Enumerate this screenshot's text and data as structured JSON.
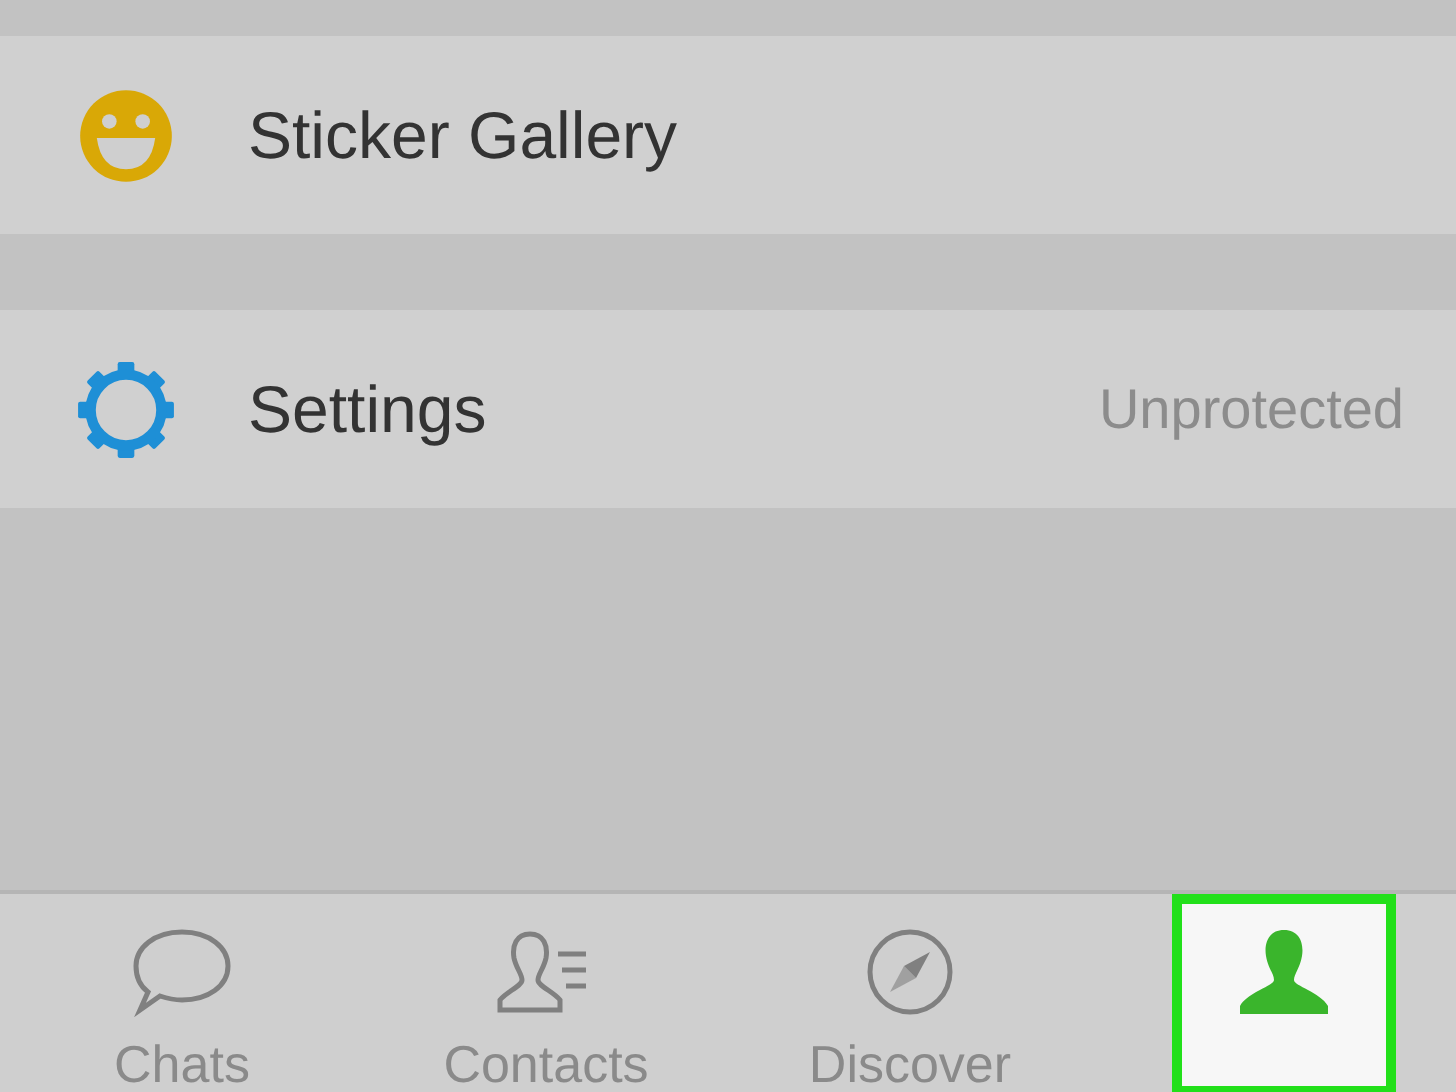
{
  "menu_groups": [
    [
      {
        "kind": "smiley",
        "label": "Sticker Gallery"
      }
    ],
    [
      {
        "kind": "gear",
        "label": "Settings",
        "detail": "Unprotected"
      }
    ]
  ],
  "tabs": [
    {
      "kind": "chat",
      "label": "Chats",
      "selected": false
    },
    {
      "kind": "contacts",
      "label": "Contacts",
      "selected": false
    },
    {
      "kind": "compass",
      "label": "Discover",
      "selected": false
    },
    {
      "kind": "person",
      "selected": true
    }
  ]
}
